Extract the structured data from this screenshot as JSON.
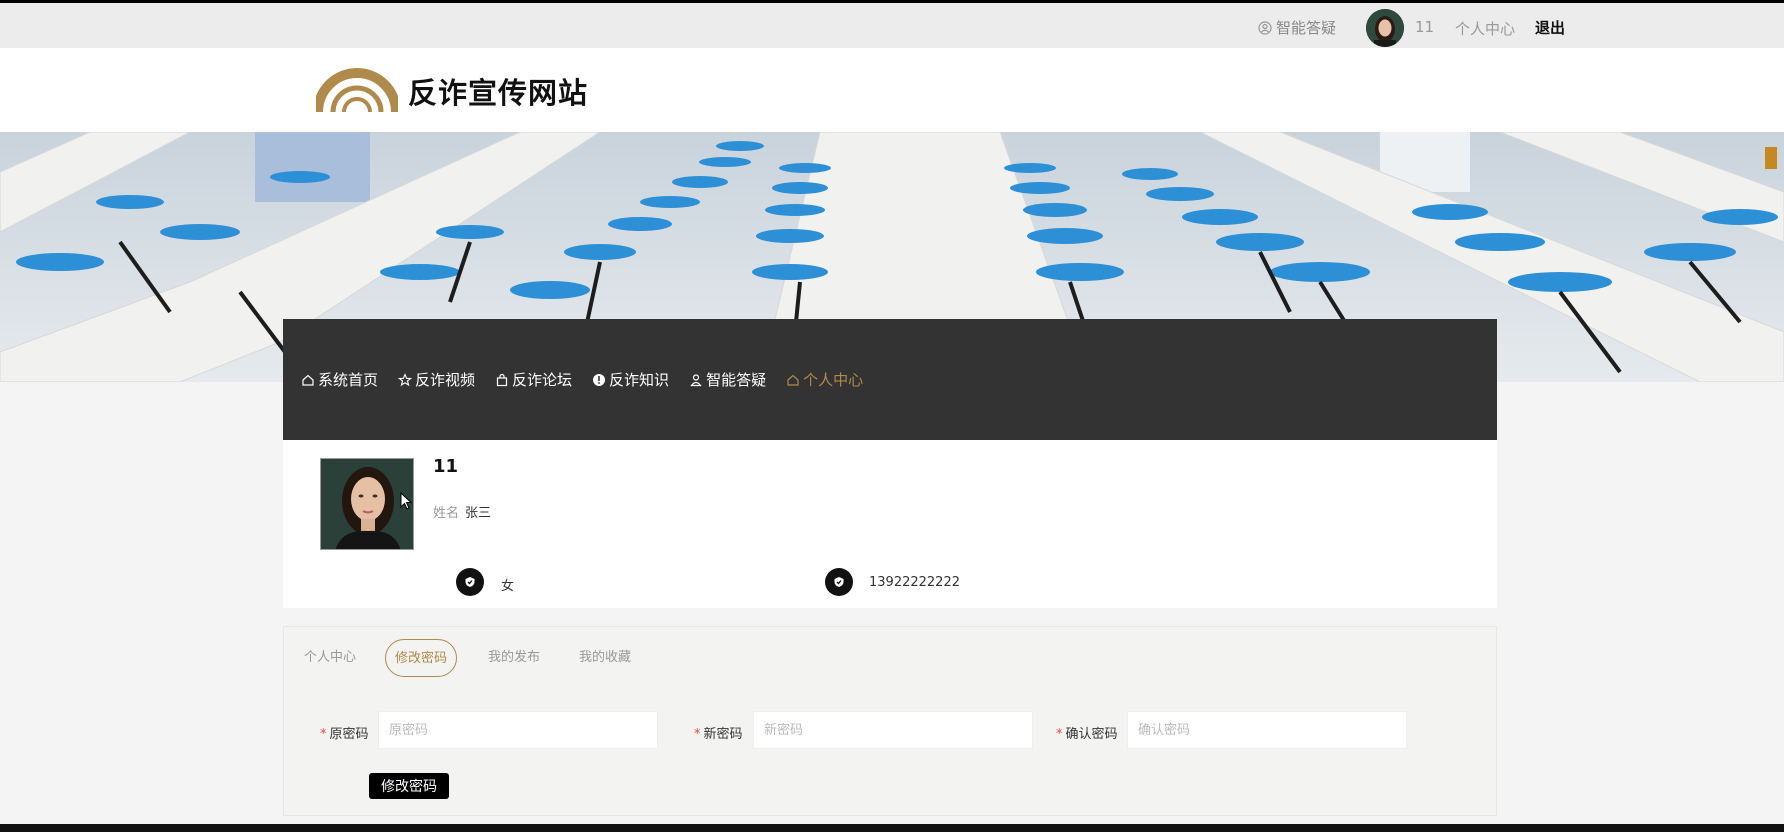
{
  "topbar": {
    "qa_label": "智能答疑",
    "username": "11",
    "center_label": "个人中心",
    "logout_label": "退出"
  },
  "header": {
    "site_title": "反诈宣传网站",
    "brand_color": "#b08a4a"
  },
  "nav": {
    "items": [
      {
        "label": "系统首页",
        "icon": "home-icon"
      },
      {
        "label": "反诈视频",
        "icon": "star-icon"
      },
      {
        "label": "反诈论坛",
        "icon": "bag-icon"
      },
      {
        "label": "反诈知识",
        "icon": "info-icon"
      },
      {
        "label": "智能答疑",
        "icon": "user-icon"
      },
      {
        "label": "个人中心",
        "icon": "home-icon"
      }
    ],
    "active_index": 5
  },
  "profile": {
    "username": "11",
    "name_label": "姓名",
    "real_name": "张三",
    "gender": "女",
    "phone": "13922222222"
  },
  "tabs": [
    {
      "label": "个人中心"
    },
    {
      "label": "修改密码"
    },
    {
      "label": "我的发布"
    },
    {
      "label": "我的收藏"
    }
  ],
  "active_tab": 1,
  "form": {
    "old_password": {
      "label": "原密码",
      "placeholder": "原密码",
      "value": ""
    },
    "new_password": {
      "label": "新密码",
      "placeholder": "新密码",
      "value": ""
    },
    "confirm_password": {
      "label": "确认密码",
      "placeholder": "确认密码",
      "value": ""
    },
    "submit_label": "修改密码"
  }
}
